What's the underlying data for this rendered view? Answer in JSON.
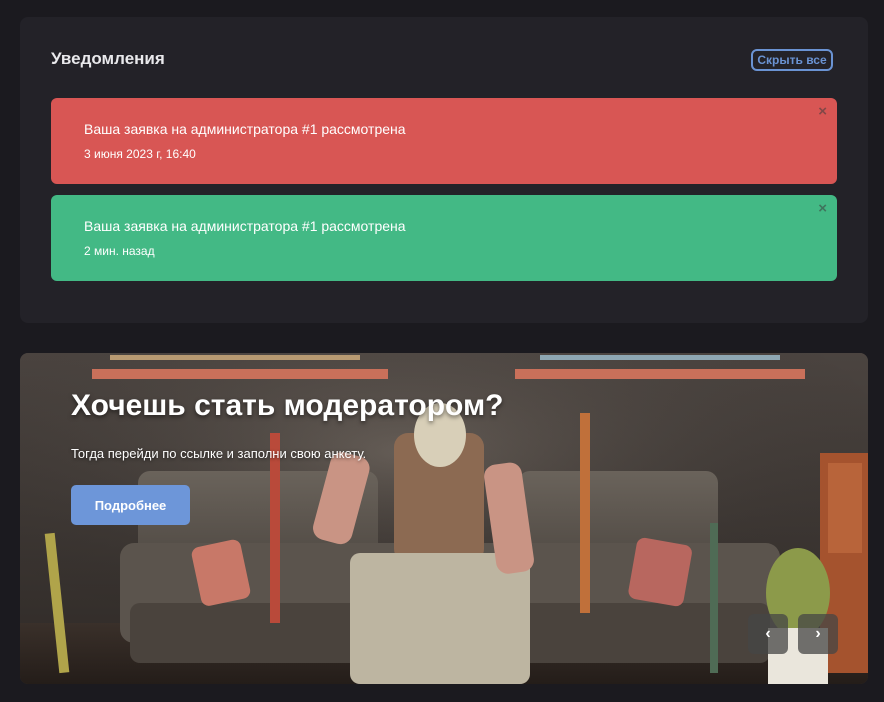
{
  "notifications_panel": {
    "title": "Уведомления",
    "hide_all_label": "Скрыть все",
    "close_glyph": "×",
    "items": [
      {
        "message": "Ваша заявка на администратора #1 рассмотрена",
        "time": "3 июня 2023 г, 16:40",
        "color": "#d85654"
      },
      {
        "message": "Ваша заявка на администратора #1 рассмотрена",
        "time": "2 мин. назад",
        "color": "#43b985"
      }
    ]
  },
  "banner": {
    "title": "Хочешь стать модератором?",
    "subtitle": "Тогда перейди по ссылке и заполни свою анкету.",
    "button_label": "Подробнее",
    "prev_glyph": "‹",
    "next_glyph": "›",
    "accent_color": "#6d96d9"
  }
}
